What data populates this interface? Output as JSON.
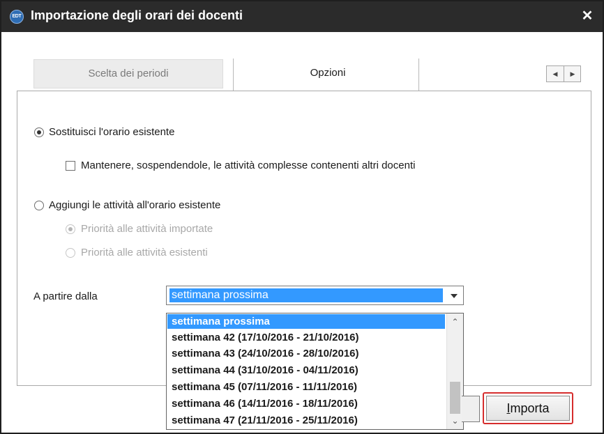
{
  "window": {
    "title": "Importazione degli orari dei docenti",
    "app_badge": "EDT",
    "close_glyph": "✕"
  },
  "tabs": [
    {
      "label": "Scelta dei periodi",
      "active": false
    },
    {
      "label": "Opzioni",
      "active": true
    }
  ],
  "tab_nav": {
    "prev_glyph": "◀",
    "next_glyph": "▶"
  },
  "options": {
    "replace_label": "Sostituisci l'orario esistente",
    "replace_checked": true,
    "keep_label": "Mantenere, sospendendole, le attività complesse contenenti altri docenti",
    "keep_checked": false,
    "add_label": "Aggiungi le attività all'orario esistente",
    "add_checked": false,
    "priority_imported_label": "Priorità alle attività importate",
    "priority_existing_label": "Priorità alle attività esistenti"
  },
  "start": {
    "label": "A partire dalla",
    "selected": "settimana prossima"
  },
  "dropdown": {
    "items": [
      "settimana prossima",
      "settimana 42 (17/10/2016 - 21/10/2016)",
      "settimana 43 (24/10/2016 - 28/10/2016)",
      "settimana 44 (31/10/2016 - 04/11/2016)",
      "settimana 45 (07/11/2016 - 11/11/2016)",
      "settimana 46 (14/11/2016 - 18/11/2016)",
      "settimana 47 (21/11/2016 - 25/11/2016)"
    ],
    "scroll_up_glyph": "⌃",
    "scroll_down_glyph": "⌄"
  },
  "buttons": {
    "import_first": "I",
    "import_rest": "mporta"
  },
  "colors": {
    "titlebar": "#2b2b2b",
    "selection": "#3399ff",
    "highlight_border": "#d62d2d"
  }
}
